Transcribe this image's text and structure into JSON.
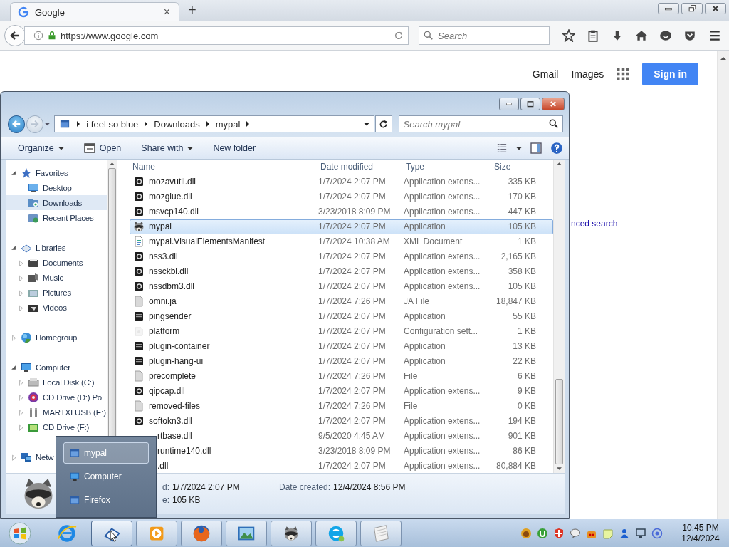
{
  "browser": {
    "tab": {
      "title": "Google",
      "close": "×"
    },
    "new_tab": "+",
    "url": "https://www.google.com",
    "search_placeholder": "Search",
    "page": {
      "links": [
        "Gmail",
        "Images"
      ],
      "sign_in": "Sign in",
      "cut_link": "nced search"
    }
  },
  "explorer": {
    "breadcrumb": [
      "i feel so blue",
      "Downloads",
      "mypal"
    ],
    "search_placeholder": "Search mypal",
    "toolbar": [
      {
        "label": "Organize",
        "kind": "menu"
      },
      {
        "label": "Open",
        "kind": "icon"
      },
      {
        "label": "Share with",
        "kind": "menu"
      },
      {
        "label": "New folder",
        "kind": "plain"
      }
    ],
    "nav": [
      {
        "label": "Favorites",
        "kind": "star",
        "expanded": true,
        "selected": false,
        "children": [
          {
            "label": "Desktop",
            "kind": "desktop",
            "selected": false
          },
          {
            "label": "Downloads",
            "kind": "downloads",
            "selected": true
          },
          {
            "label": "Recent Places",
            "kind": "recent",
            "selected": false
          }
        ]
      },
      {
        "label": "Libraries",
        "kind": "library",
        "expanded": true,
        "selected": false,
        "children": [
          {
            "label": "Documents",
            "kind": "documents",
            "expanded": false,
            "selected": false
          },
          {
            "label": "Music",
            "kind": "music",
            "expanded": false,
            "selected": false
          },
          {
            "label": "Pictures",
            "kind": "pictures",
            "expanded": false,
            "selected": false
          },
          {
            "label": "Videos",
            "kind": "videos",
            "expanded": false,
            "selected": false
          }
        ]
      },
      {
        "label": "Homegroup",
        "kind": "homegroup",
        "expanded": false,
        "selected": false
      },
      {
        "label": "Computer",
        "kind": "computer",
        "expanded": true,
        "selected": false,
        "children": [
          {
            "label": "Local Disk (C:)",
            "kind": "disk",
            "expanded": false,
            "selected": false
          },
          {
            "label": "CD Drive (D:) Po",
            "kind": "cd",
            "expanded": false,
            "selected": false
          },
          {
            "label": "MARTXI USB (E:)",
            "kind": "usb",
            "expanded": false,
            "selected": false
          },
          {
            "label": "CD Drive (F:)",
            "kind": "cdf",
            "expanded": false,
            "selected": false
          }
        ]
      },
      {
        "label": "Netw",
        "kind": "network",
        "expanded": false,
        "selected": false
      }
    ],
    "columns": [
      "Name",
      "Date modified",
      "Type",
      "Size"
    ],
    "files": [
      {
        "name": "mozavutil.dll",
        "date": "1/7/2024 2:07 PM",
        "type": "Application extens...",
        "size": "335 KB",
        "kind": "dll",
        "selected": false
      },
      {
        "name": "mozglue.dll",
        "date": "1/7/2024 2:07 PM",
        "type": "Application extens...",
        "size": "170 KB",
        "kind": "dll",
        "selected": false
      },
      {
        "name": "msvcp140.dll",
        "date": "3/23/2018 8:09 PM",
        "type": "Application extens...",
        "size": "447 KB",
        "kind": "dll",
        "selected": false
      },
      {
        "name": "mypal",
        "date": "1/7/2024 2:07 PM",
        "type": "Application",
        "size": "105 KB",
        "kind": "mypal",
        "selected": true
      },
      {
        "name": "mypal.VisualElementsManifest",
        "date": "1/7/2024 10:38 AM",
        "type": "XML Document",
        "size": "1 KB",
        "kind": "xml",
        "selected": false
      },
      {
        "name": "nss3.dll",
        "date": "1/7/2024 2:07 PM",
        "type": "Application extens...",
        "size": "2,165 KB",
        "kind": "dll",
        "selected": false
      },
      {
        "name": "nssckbi.dll",
        "date": "1/7/2024 2:07 PM",
        "type": "Application extens...",
        "size": "358 KB",
        "kind": "dll",
        "selected": false
      },
      {
        "name": "nssdbm3.dll",
        "date": "1/7/2024 2:07 PM",
        "type": "Application extens...",
        "size": "105 KB",
        "kind": "dll",
        "selected": false
      },
      {
        "name": "omni.ja",
        "date": "1/7/2024 7:26 PM",
        "type": "JA File",
        "size": "18,847 KB",
        "kind": "blank",
        "selected": false
      },
      {
        "name": "pingsender",
        "date": "1/7/2024 2:07 PM",
        "type": "Application",
        "size": "55 KB",
        "kind": "app",
        "selected": false
      },
      {
        "name": "platform",
        "date": "1/7/2024 2:07 PM",
        "type": "Configuration sett...",
        "size": "1 KB",
        "kind": "config",
        "selected": false
      },
      {
        "name": "plugin-container",
        "date": "1/7/2024 2:07 PM",
        "type": "Application",
        "size": "13 KB",
        "kind": "app",
        "selected": false
      },
      {
        "name": "plugin-hang-ui",
        "date": "1/7/2024 2:07 PM",
        "type": "Application",
        "size": "22 KB",
        "kind": "app",
        "selected": false
      },
      {
        "name": "precomplete",
        "date": "1/7/2024 7:26 PM",
        "type": "File",
        "size": "6 KB",
        "kind": "blank",
        "selected": false
      },
      {
        "name": "qipcap.dll",
        "date": "1/7/2024 2:07 PM",
        "type": "Application extens...",
        "size": "9 KB",
        "kind": "dll",
        "selected": false
      },
      {
        "name": "removed-files",
        "date": "1/7/2024 7:26 PM",
        "type": "File",
        "size": "0 KB",
        "kind": "blank",
        "selected": false
      },
      {
        "name": "softokn3.dll",
        "date": "1/7/2024 2:07 PM",
        "type": "Application extens...",
        "size": "194 KB",
        "kind": "dll",
        "selected": false
      },
      {
        "name": "rtbase.dll",
        "date": "9/5/2020 4:45 AM",
        "type": "Application extens...",
        "size": "901 KB",
        "kind": "covered",
        "selected": false
      },
      {
        "name": "runtime140.dll",
        "date": "3/23/2018 8:09 PM",
        "type": "Application extens...",
        "size": "86 KB",
        "kind": "covered",
        "selected": false
      },
      {
        "name": ".dll",
        "date": "1/7/2024 2:07 PM",
        "type": "Application extens...",
        "size": "80,884 KB",
        "kind": "covered",
        "selected": false
      }
    ],
    "details": {
      "modified_label": "d:",
      "modified": "1/7/2024 2:07 PM",
      "created_label": "Date created:",
      "created": "12/4/2024 8:56 PM",
      "size_label": "e:",
      "size": "105 KB"
    }
  },
  "jump_list": [
    {
      "label": "mypal",
      "kind": "window",
      "selected": true
    },
    {
      "label": "Computer",
      "kind": "computer",
      "selected": false
    },
    {
      "label": "Firefox",
      "kind": "window",
      "selected": false
    }
  ],
  "taskbar": {
    "buttons": [
      {
        "kind": "ie",
        "running": false,
        "selected": false
      },
      {
        "kind": "explorer",
        "running": true,
        "selected": true
      },
      {
        "kind": "media",
        "running": true,
        "selected": false
      },
      {
        "kind": "firefox",
        "running": true,
        "selected": false
      },
      {
        "kind": "photos",
        "running": true,
        "selected": false
      },
      {
        "kind": "mypal",
        "running": true,
        "selected": false
      },
      {
        "kind": "skype",
        "running": true,
        "selected": false
      },
      {
        "kind": "notepad",
        "running": true,
        "selected": false
      }
    ],
    "clock": {
      "time": "10:45 PM",
      "date": "12/4/2024"
    }
  }
}
